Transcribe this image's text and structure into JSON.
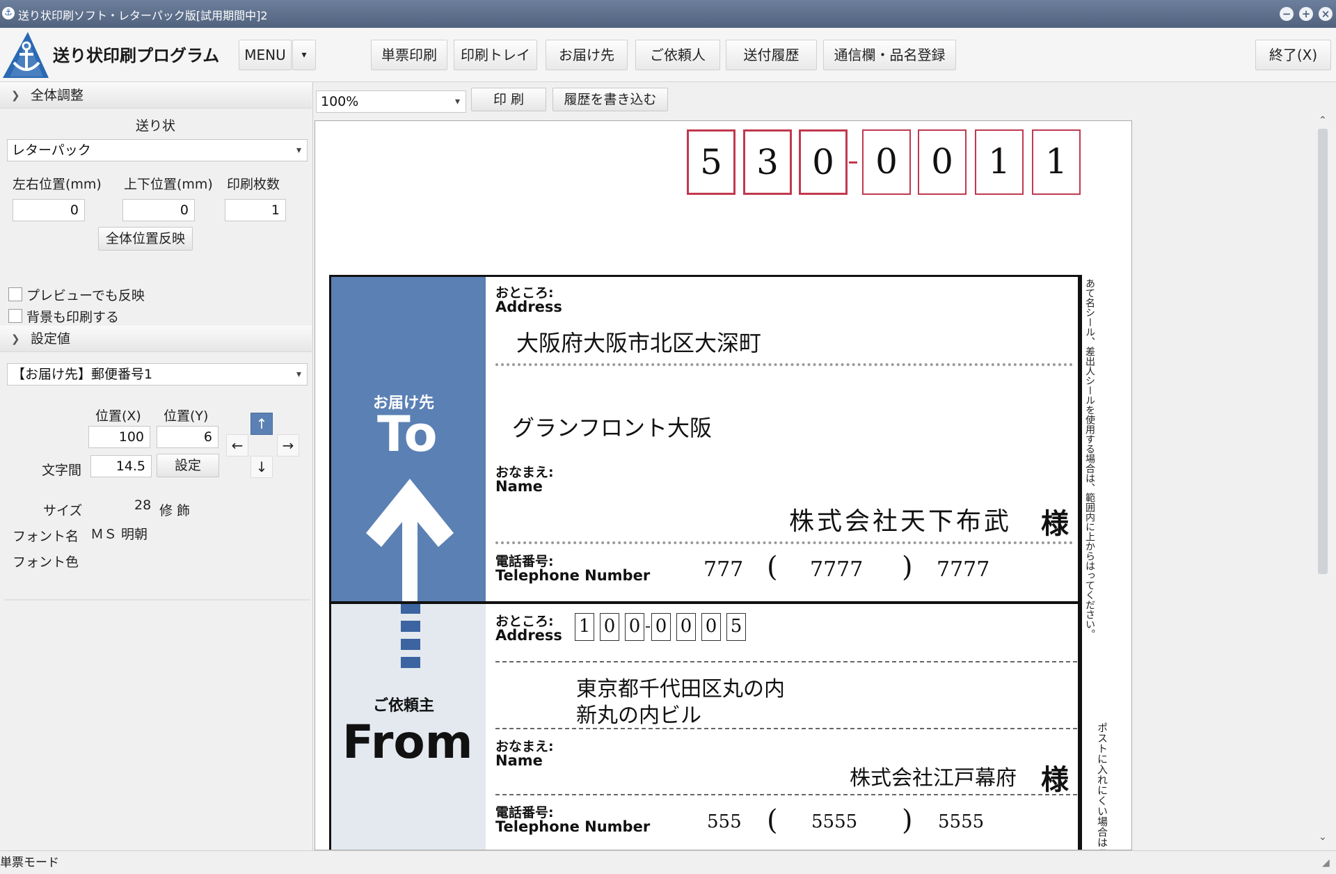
{
  "window": {
    "title": "送り状印刷ソフト・レターパック版[試用期間中]2"
  },
  "toolbar": {
    "app_name": "送り状印刷プログラム",
    "menu_label": "MENU",
    "menu_arrow": "▾",
    "buttons": [
      "単票印刷",
      "印刷トレイ",
      "お届け先",
      "ご依頼人",
      "送付履歴",
      "通信欄・品名登録"
    ],
    "exit_label": "終了(X)"
  },
  "left_panel": {
    "overall": {
      "header": "全体調整",
      "slip_label": "送り状",
      "slip_value": "レターパック",
      "lr_label": "左右位置(mm)",
      "ud_label": "上下位置(mm)",
      "copies_label": "印刷枚数",
      "lr_value": "0",
      "ud_value": "0",
      "copies_value": "1",
      "apply_label": "全体位置反映",
      "preview_reflect": "プレビューでも反映",
      "print_bg": "背景も印刷する"
    },
    "settings": {
      "header": "設定値",
      "field_value": "【お届け先】郵便番号1",
      "posx_label": "位置(X)",
      "posy_label": "位置(Y)",
      "posx_value": "100",
      "posy_value": "6",
      "spacing_label": "文字間",
      "spacing_value": "14.5",
      "set_label": "設定",
      "size_label": "サイズ",
      "size_value": "28",
      "decor_label": "修 飾",
      "font_name_label": "フォント名",
      "font_name_value": "ＭＳ 明朝",
      "font_color_label": "フォント色",
      "arrows": {
        "up": "↑",
        "down": "↓",
        "left": "←",
        "right": "→"
      }
    }
  },
  "preview": {
    "zoom": "100%",
    "print_label": "印 刷",
    "history_label": "履歴を書き込む",
    "zip_digits": [
      "5",
      "3",
      "0",
      "0",
      "0",
      "1",
      "1"
    ],
    "to": {
      "band_jp": "お届け先",
      "band_en": "To",
      "address_jp": "おところ:",
      "address_en": "Address",
      "address1": "大阪府大阪市北区大深町",
      "address2": "グランフロント大阪",
      "name_jp": "おなまえ:",
      "name_en": "Name",
      "name": "株式会社天下布武",
      "honorific": "様",
      "tel_jp": "電話番号:",
      "tel_en": "Telephone Number",
      "tel1": "777",
      "tel2": "7777",
      "tel3": "7777",
      "paren_open": "(",
      "paren_close": ")"
    },
    "from": {
      "band_jp": "ご依頼主",
      "band_en": "From",
      "address_jp": "おところ:",
      "address_en": "Address",
      "zip_digits": [
        "1",
        "0",
        "0",
        "0",
        "0",
        "0",
        "5"
      ],
      "address1": "東京都千代田区丸の内",
      "address2": "新丸の内ビル",
      "name_jp": "おなまえ:",
      "name_en": "Name",
      "name": "株式会社江戸幕府",
      "honorific": "様",
      "tel_jp": "電話番号:",
      "tel_en": "Telephone Number",
      "tel1": "555",
      "tel2": "5555",
      "tel3": "5555",
      "paren_open": "(",
      "paren_close": ")"
    },
    "side_note1": "あて名シール、差出人シールを使用する場合は、範囲内に上からはってください。",
    "side_note2": "ポストに入れにくい場合はこ"
  },
  "status": {
    "mode": "単票モード"
  },
  "colors": {
    "zip_border": "#c0394f",
    "to_band": "#5b80b4",
    "from_band": "#e4e9f0",
    "titlebar": "#5a6b87"
  }
}
